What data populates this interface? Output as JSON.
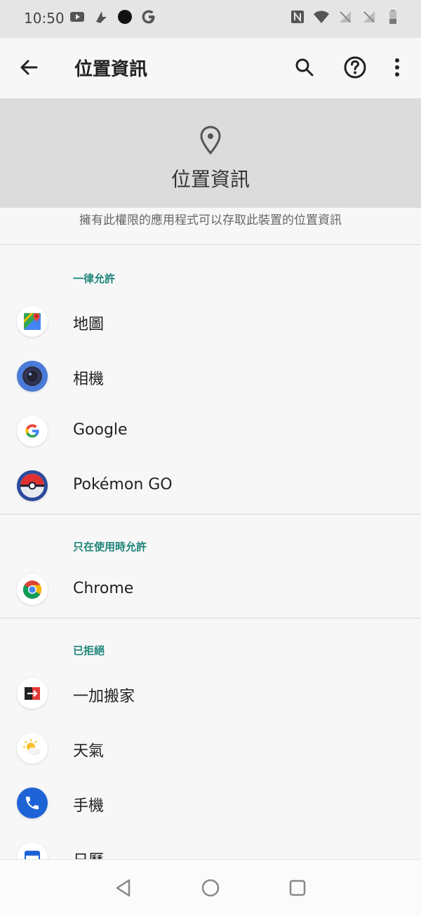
{
  "status_bar": {
    "time": "10:50"
  },
  "app_bar": {
    "title": "位置資訊"
  },
  "header": {
    "title": "位置資訊",
    "description": "擁有此權限的應用程式可以存取此裝置的位置資訊"
  },
  "sections": {
    "always": {
      "label": "一律允許",
      "items": [
        {
          "label": "地圖",
          "icon": "maps-icon"
        },
        {
          "label": "相機",
          "icon": "camera-icon"
        },
        {
          "label": "Google",
          "icon": "google-icon"
        },
        {
          "label": "Pokémon GO",
          "icon": "pokemon-go-icon"
        }
      ]
    },
    "while_using": {
      "label": "只在使用時允許",
      "items": [
        {
          "label": "Chrome",
          "icon": "chrome-icon"
        }
      ]
    },
    "denied": {
      "label": "已拒絕",
      "items": [
        {
          "label": "一加搬家",
          "icon": "oneplus-switch-icon"
        },
        {
          "label": "天氣",
          "icon": "weather-icon"
        },
        {
          "label": "手機",
          "icon": "phone-icon"
        },
        {
          "label": "日曆",
          "icon": "calendar-icon"
        }
      ]
    }
  },
  "colors": {
    "accent": "#1e8579",
    "header_bg": "#dcdcdc",
    "background": "#f7f7f7"
  }
}
